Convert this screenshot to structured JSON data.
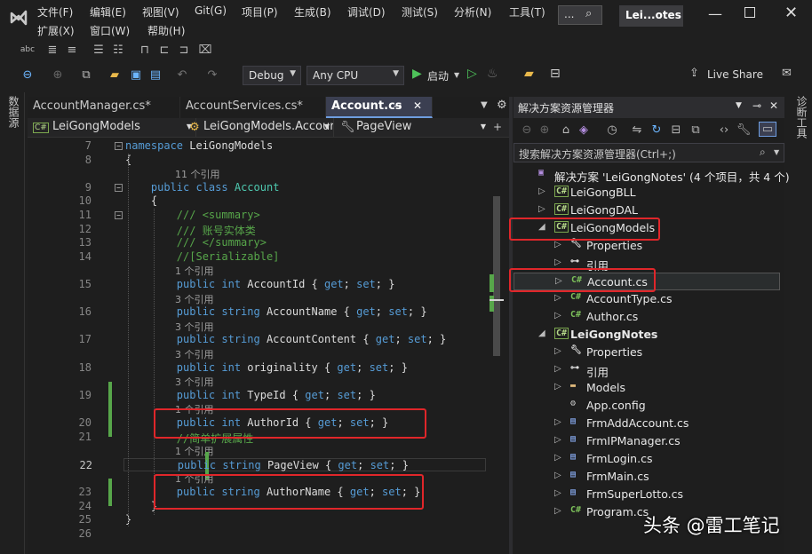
{
  "menu": {
    "row1": [
      "文件(F)",
      "编辑(E)",
      "视图(V)",
      "Git(G)",
      "项目(P)",
      "生成(B)",
      "调试(D)",
      "测试(S)",
      "分析(N)",
      "工具(T)"
    ],
    "row2": [
      "扩展(X)",
      "窗口(W)",
      "帮助(H)"
    ],
    "more": "...",
    "window_title": "Lei...otes"
  },
  "toolbar": {
    "config": "Debug",
    "platform": "Any CPU",
    "start_label": "启动",
    "live_share": "Live Share"
  },
  "side_tabs": {
    "left": "数据源",
    "right": "诊断工具"
  },
  "editor": {
    "tabs": [
      {
        "label": "AccountManager.cs*",
        "active": false
      },
      {
        "label": "AccountServices.cs*",
        "active": false
      },
      {
        "label": "Account.cs",
        "active": true
      }
    ],
    "nav": {
      "project": "LeiGongModels",
      "type": "LeiGongModels.Accour",
      "member": "PageView"
    },
    "lines": [
      {
        "n": "7",
        "parts": [
          [
            "kw",
            "namespace"
          ],
          [
            "pl",
            " LeiGongModels"
          ]
        ]
      },
      {
        "n": "8",
        "parts": [
          [
            "pl",
            "{"
          ]
        ]
      },
      {
        "ref": "11 个引用"
      },
      {
        "n": "9",
        "parts": [
          [
            "pl",
            "    "
          ],
          [
            "kw",
            "public class"
          ],
          [
            "pl",
            " "
          ],
          [
            "ty",
            "Account"
          ]
        ]
      },
      {
        "n": "10",
        "parts": [
          [
            "pl",
            "    {"
          ]
        ]
      },
      {
        "n": "11",
        "parts": [
          [
            "pl",
            "        "
          ],
          [
            "cm",
            "/// <summary>"
          ]
        ]
      },
      {
        "n": "12",
        "parts": [
          [
            "pl",
            "        "
          ],
          [
            "cm",
            "/// 账号实体类"
          ]
        ]
      },
      {
        "n": "13",
        "parts": [
          [
            "pl",
            "        "
          ],
          [
            "cm",
            "/// </summary>"
          ]
        ]
      },
      {
        "n": "14",
        "parts": [
          [
            "pl",
            "        "
          ],
          [
            "cm",
            "//[Serializable]"
          ]
        ]
      },
      {
        "ref": "1 个引用"
      },
      {
        "n": "15",
        "parts": [
          [
            "pl",
            "        "
          ],
          [
            "kw",
            "public int"
          ],
          [
            "pl",
            " AccountId { "
          ],
          [
            "kw",
            "get"
          ],
          [
            "pl",
            "; "
          ],
          [
            "kw",
            "set"
          ],
          [
            "pl",
            "; }"
          ]
        ]
      },
      {
        "ref": "3 个引用"
      },
      {
        "n": "16",
        "parts": [
          [
            "pl",
            "        "
          ],
          [
            "kw",
            "public string"
          ],
          [
            "pl",
            " AccountName { "
          ],
          [
            "kw",
            "get"
          ],
          [
            "pl",
            "; "
          ],
          [
            "kw",
            "set"
          ],
          [
            "pl",
            "; }"
          ]
        ]
      },
      {
        "ref": "3 个引用"
      },
      {
        "n": "17",
        "parts": [
          [
            "pl",
            "        "
          ],
          [
            "kw",
            "public string"
          ],
          [
            "pl",
            " AccountContent { "
          ],
          [
            "kw",
            "get"
          ],
          [
            "pl",
            "; "
          ],
          [
            "kw",
            "set"
          ],
          [
            "pl",
            "; }"
          ]
        ]
      },
      {
        "ref": "3 个引用"
      },
      {
        "n": "18",
        "parts": [
          [
            "pl",
            "        "
          ],
          [
            "kw",
            "public int"
          ],
          [
            "pl",
            " originality { "
          ],
          [
            "kw",
            "get"
          ],
          [
            "pl",
            "; "
          ],
          [
            "kw",
            "set"
          ],
          [
            "pl",
            "; }"
          ]
        ]
      },
      {
        "ref": "3 个引用"
      },
      {
        "n": "19",
        "parts": [
          [
            "pl",
            "        "
          ],
          [
            "kw",
            "public int"
          ],
          [
            "pl",
            " TypeId { "
          ],
          [
            "kw",
            "get"
          ],
          [
            "pl",
            "; "
          ],
          [
            "kw",
            "set"
          ],
          [
            "pl",
            "; }"
          ]
        ]
      },
      {
        "ref": "1 个引用"
      },
      {
        "n": "20",
        "parts": [
          [
            "pl",
            "        "
          ],
          [
            "kw",
            "public int"
          ],
          [
            "pl",
            " AuthorId { "
          ],
          [
            "kw",
            "get"
          ],
          [
            "pl",
            "; "
          ],
          [
            "kw",
            "set"
          ],
          [
            "pl",
            "; }"
          ]
        ]
      },
      {
        "n": "21",
        "parts": [
          [
            "pl",
            "        "
          ],
          [
            "cm",
            "//简单扩展属性"
          ]
        ]
      },
      {
        "ref": "1 个引用"
      },
      {
        "n": "22",
        "parts": [
          [
            "pl",
            "        "
          ],
          [
            "kw",
            "public string"
          ],
          [
            "pl",
            " PageView { "
          ],
          [
            "kw",
            "get"
          ],
          [
            "pl",
            "; "
          ],
          [
            "kw",
            "set"
          ],
          [
            "pl",
            "; }"
          ]
        ]
      },
      {
        "ref": "1 个引用"
      },
      {
        "n": "23",
        "parts": [
          [
            "pl",
            "        "
          ],
          [
            "kw",
            "public string"
          ],
          [
            "pl",
            " AuthorName { "
          ],
          [
            "kw",
            "get"
          ],
          [
            "pl",
            "; "
          ],
          [
            "kw",
            "set"
          ],
          [
            "pl",
            "; }"
          ]
        ]
      },
      {
        "n": "24",
        "parts": [
          [
            "pl",
            "    }"
          ]
        ]
      },
      {
        "n": "25",
        "parts": [
          [
            "pl",
            "}"
          ]
        ]
      },
      {
        "n": "26",
        "parts": []
      }
    ]
  },
  "solution": {
    "header": "解决方案资源管理器",
    "search_placeholder": "搜索解决方案资源管理器(Ctrl+;)",
    "tree": [
      {
        "label": "解决方案 'LeiGongNotes' (4 个项目，共 4 个)",
        "icon": "solution",
        "exp": ""
      },
      {
        "label": "LeiGongBLL",
        "icon": "cs-project",
        "exp": "▷"
      },
      {
        "label": "LeiGongDAL",
        "icon": "cs-project",
        "exp": "▷"
      },
      {
        "label": "LeiGongModels",
        "icon": "cs-project",
        "exp": "◢"
      },
      {
        "label": "Properties",
        "icon": "wrench",
        "exp": "▷"
      },
      {
        "label": "引用",
        "icon": "references",
        "exp": "▷"
      },
      {
        "label": "Account.cs",
        "icon": "cs-file",
        "exp": "▷"
      },
      {
        "label": "AccountType.cs",
        "icon": "cs-file",
        "exp": "▷"
      },
      {
        "label": "Author.cs",
        "icon": "cs-file",
        "exp": "▷"
      },
      {
        "label": "LeiGongNotes",
        "icon": "cs-project",
        "exp": "◢"
      },
      {
        "label": "Properties",
        "icon": "wrench",
        "exp": "▷"
      },
      {
        "label": "引用",
        "icon": "references",
        "exp": "▷"
      },
      {
        "label": "Models",
        "icon": "folder",
        "exp": "▷"
      },
      {
        "label": "App.config",
        "icon": "config",
        "exp": ""
      },
      {
        "label": "FrmAddAccount.cs",
        "icon": "form",
        "exp": "▷"
      },
      {
        "label": "FrmIPManager.cs",
        "icon": "form",
        "exp": "▷"
      },
      {
        "label": "FrmLogin.cs",
        "icon": "form",
        "exp": "▷"
      },
      {
        "label": "FrmMain.cs",
        "icon": "form",
        "exp": "▷"
      },
      {
        "label": "FrmSuperLotto.cs",
        "icon": "form",
        "exp": "▷"
      },
      {
        "label": "Program.cs",
        "icon": "cs-file",
        "exp": "▷"
      }
    ]
  },
  "watermark": "头条 @雷工笔记",
  "colors": {
    "highlight": "#e0262a",
    "accent": "#6e9de0"
  }
}
